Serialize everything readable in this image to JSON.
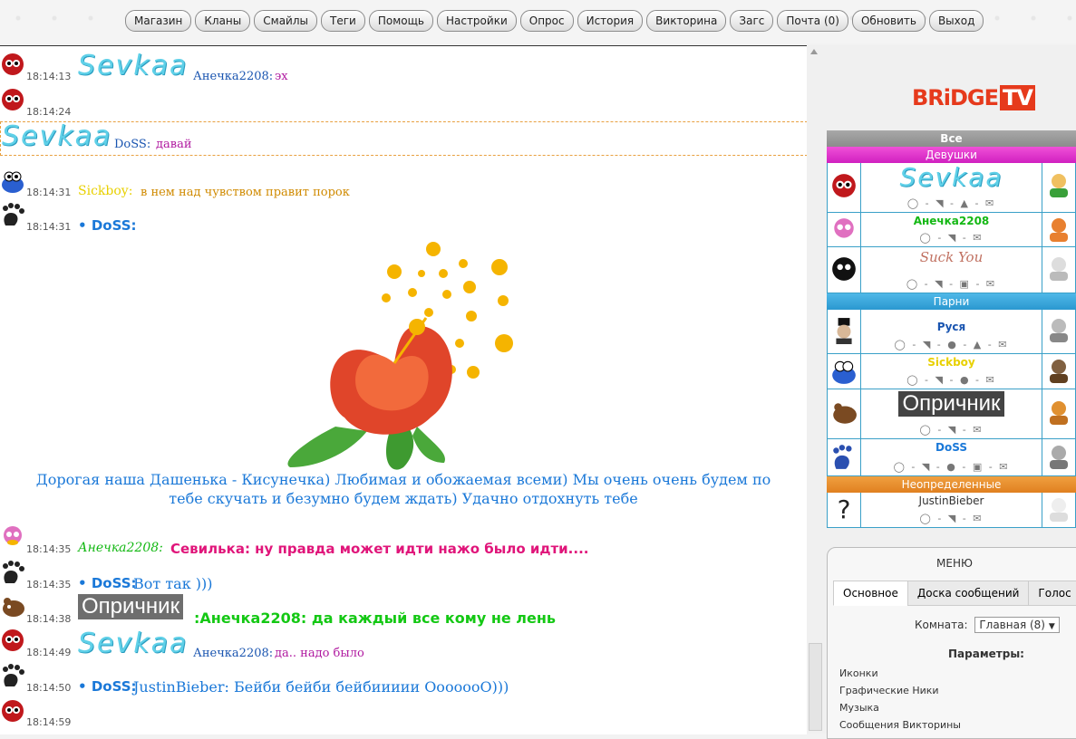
{
  "nav": [
    "Магазин",
    "Кланы",
    "Смайлы",
    "Теги",
    "Помощь",
    "Настройки",
    "Опрос",
    "История",
    "Викторина",
    "Загс",
    "Почта (0)",
    "Обновить",
    "Выход"
  ],
  "chat": {
    "r1": {
      "time": "18:14:13",
      "nick": "Sevkaa",
      "to": "Анечка2208:",
      "text": "эх"
    },
    "r2": {
      "time": "18:14:24"
    },
    "r2b": {
      "nick": "Sevkaa",
      "to": "DoSS:",
      "text": "давай"
    },
    "r3": {
      "time": "18:14:31",
      "nick": "Sickboy:",
      "text": "в нем над чувством правит порок"
    },
    "r4": {
      "time": "18:14:31",
      "nick": "DoSS:"
    },
    "flower_caption": "Дорогая наша Дашенька - Кисунечка) Любимая и обожаемая всеми) Мы очень очень будем по тебе скучать и безумно будем ждать) Удачно отдохнуть тебе",
    "r5": {
      "time": "18:14:35",
      "nick": "Анечка2208:",
      "text": "Севилька: ну правда может идти нажо было идти...."
    },
    "r6": {
      "time": "18:14:35",
      "nick": "DoSS:",
      "text": "Вот так )))"
    },
    "r7": {
      "time": "18:14:38",
      "nick": "Опричник",
      "text": ":Анечка2208: да каждый все кому не лень"
    },
    "r8": {
      "time": "18:14:49",
      "nick": "Sevkaa",
      "to": "Анечка2208:",
      "text": "да.. надо было"
    },
    "r9": {
      "time": "18:14:50",
      "nick": "DoSS:",
      "text": "JustinBieber: Бейби бейби бейбиииии ОоооооО)))"
    },
    "r10": {
      "time": "18:14:59"
    }
  },
  "logo": {
    "a": "BRiDGE",
    "b": "TV"
  },
  "users": {
    "all": "Все",
    "girls": "Девушки",
    "boys": "Парни",
    "undef": "Неопределенные",
    "list": {
      "sevkaa": "Sevkaa",
      "anechka": "Анечка2208",
      "suckyou": "Suck You",
      "rusya": "Руся",
      "sickboy": "Sickboy",
      "oprichnik": "Опричник",
      "doss": "DoSS",
      "justin": "JustinBieber"
    }
  },
  "menu": {
    "title": "МЕНЮ",
    "tabs": [
      "Основное",
      "Доска сообщений",
      "Голос"
    ],
    "room_label": "Комната:",
    "room_value": "Главная (8)",
    "params": "Параметры:",
    "links": [
      "Иконки",
      "Графические Ники",
      "Музыка",
      "Сообщения Викторины"
    ]
  }
}
